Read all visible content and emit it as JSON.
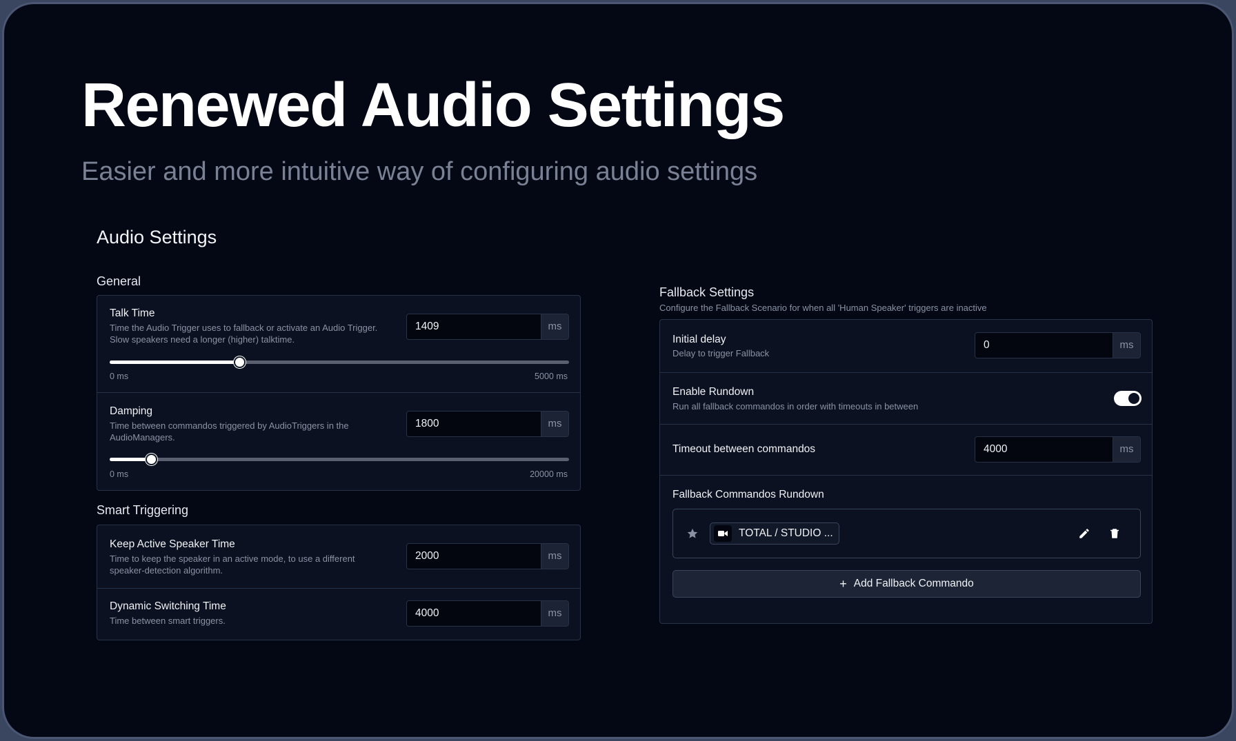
{
  "hero": {
    "title": "Renewed Audio Settings",
    "subtitle": "Easier and more intuitive way of configuring audio settings"
  },
  "section_title": "Audio Settings",
  "general": {
    "title": "General",
    "talk_time": {
      "label": "Talk Time",
      "description": "Time the Audio Trigger uses to fallback or activate an Audio Trigger. Slow speakers need a longer (higher) talktime.",
      "value": "1409",
      "unit": "ms",
      "slider_min": 0,
      "slider_max": 5000,
      "slider_value": 1409,
      "min_label": "0 ms",
      "max_label": "5000 ms"
    },
    "damping": {
      "label": "Damping",
      "description": "Time between commandos triggered by AudioTriggers in the AudioManagers.",
      "value": "1800",
      "unit": "ms",
      "slider_min": 0,
      "slider_max": 20000,
      "slider_value": 1800,
      "min_label": "0 ms",
      "max_label": "20000 ms"
    }
  },
  "smart": {
    "title": "Smart Triggering",
    "keep_active": {
      "label": "Keep Active Speaker Time",
      "description": "Time to keep the speaker in an active mode, to use a different speaker-detection algorithm.",
      "value": "2000",
      "unit": "ms"
    },
    "dynamic": {
      "label": "Dynamic Switching Time",
      "description": "Time between smart triggers.",
      "value": "4000",
      "unit": "ms"
    }
  },
  "fallback": {
    "title": "Fallback Settings",
    "description": "Configure the Fallback Scenario for when all 'Human Speaker' triggers are inactive",
    "initial_delay": {
      "label": "Initial delay",
      "description": "Delay to trigger Fallback",
      "value": "0",
      "unit": "ms"
    },
    "rundown_toggle": {
      "label": "Enable Rundown",
      "description": "Run all fallback commandos in order with timeouts in between",
      "enabled": true
    },
    "timeout": {
      "label": "Timeout between commandos",
      "value": "4000",
      "unit": "ms"
    },
    "commandos": {
      "title": "Fallback Commandos Rundown",
      "items": [
        {
          "label": "TOTAL / STUDIO ..."
        }
      ],
      "add_label": "Add Fallback Commando"
    }
  },
  "colors": {
    "background": "#040814",
    "card": "#0b1120",
    "border": "#283247",
    "accent": "#ffffff"
  }
}
